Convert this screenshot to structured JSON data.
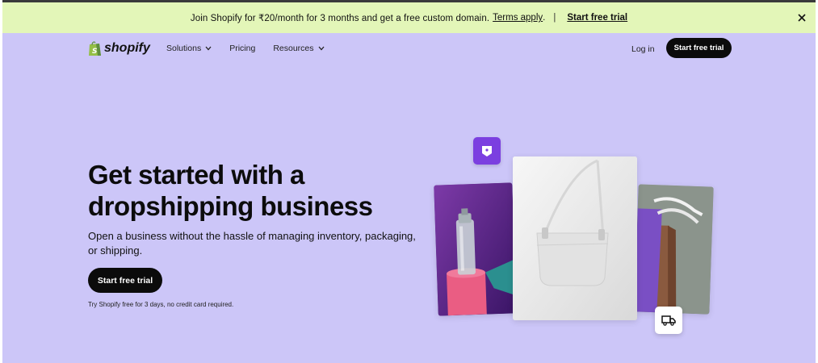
{
  "banner": {
    "text": "Join Shopify for ₹20/month for 3 months and get a free custom domain.",
    "terms_link": "Terms apply",
    "terms_suffix": ".",
    "separator": "|",
    "cta": "Start free trial"
  },
  "nav": {
    "brand": "shopify",
    "items": [
      {
        "label": "Solutions",
        "has_dropdown": true
      },
      {
        "label": "Pricing",
        "has_dropdown": false
      },
      {
        "label": "Resources",
        "has_dropdown": true
      }
    ],
    "login": "Log in",
    "cta": "Start free trial"
  },
  "hero": {
    "title": "Get started with a dropshipping business",
    "subtitle": "Open a business without the hassle of managing inventory, packaging, or shipping.",
    "cta": "Start free trial",
    "note": "Try Shopify free for 3 days, no credit card required."
  },
  "illustration": {
    "icons": [
      "tag-icon",
      "truck-icon"
    ]
  },
  "colors": {
    "page_bg": "#ccc6f8",
    "banner_bg": "#e3f6b8",
    "button_bg": "#0b0b0b",
    "brand_green": "#95bf47",
    "accent_purple": "#7b3fe0"
  }
}
